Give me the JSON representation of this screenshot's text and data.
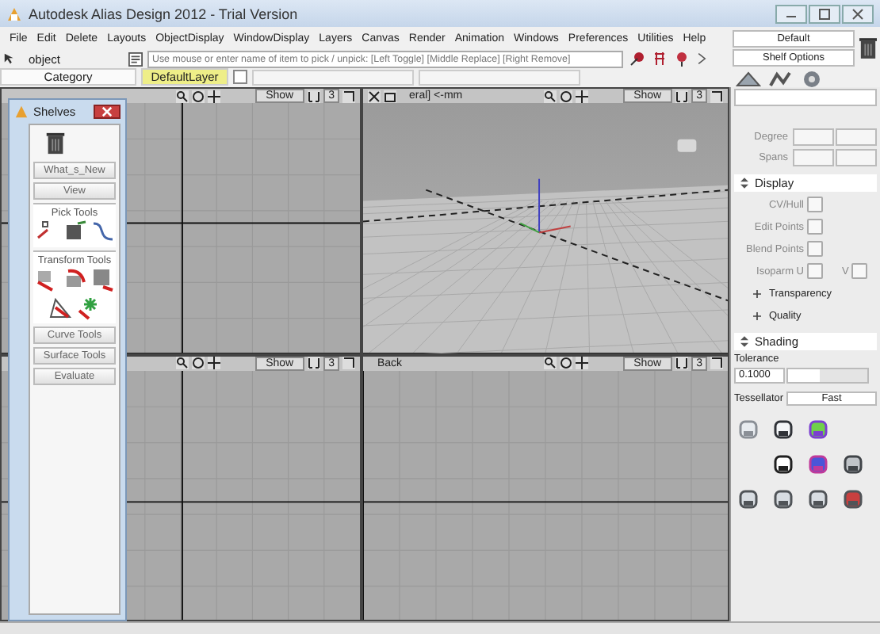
{
  "window": {
    "title": "Autodesk Alias Design 2012 - Trial Version"
  },
  "menu": [
    "File",
    "Edit",
    "Delete",
    "Layouts",
    "ObjectDisplay",
    "WindowDisplay",
    "Layers",
    "Canvas",
    "Render",
    "Animation",
    "Windows",
    "Preferences",
    "Utilities",
    "Help"
  ],
  "command": {
    "mode": "object",
    "prompt": "Use mouse or enter name of item to pick / unpick: [Left Toggle] [Middle Replace] [Right Remove]"
  },
  "layers": {
    "category": "Category",
    "layer": "DefaultLayer",
    "checked": false
  },
  "shelf_selector": {
    "shelf": "Default",
    "options": "Shelf Options"
  },
  "viewports": [
    {
      "kind": "ortho",
      "show": "Show",
      "count": "3"
    },
    {
      "kind": "perspective",
      "label": "eral] <-mm",
      "show": "Show",
      "count": "3"
    },
    {
      "kind": "ortho",
      "show": "Show",
      "count": "3"
    },
    {
      "kind": "ortho",
      "label": "Back",
      "show": "Show",
      "count": "3"
    }
  ],
  "shelves": {
    "title": "Shelves",
    "buttons": [
      "What_s_New",
      "View"
    ],
    "sections": [
      {
        "title": "Pick Tools",
        "kind": "pick"
      },
      {
        "title": "Transform Tools",
        "kind": "transform"
      }
    ],
    "collapsed": [
      "Curve Tools",
      "Surface Tools",
      "Evaluate"
    ]
  },
  "panel": {
    "fields": [
      {
        "label": "Degree"
      },
      {
        "label": "Spans"
      }
    ],
    "display": {
      "title": "Display",
      "toggles": [
        {
          "label": "CV/Hull",
          "checked": false
        },
        {
          "label": "Edit Points",
          "checked": false
        },
        {
          "label": "Blend Points",
          "checked": false
        },
        {
          "label": "Isoparm U",
          "checked": false,
          "extra": "V",
          "extra_checked": false
        }
      ],
      "expanders": [
        "Transparency",
        "Quality"
      ]
    },
    "shading": {
      "title": "Shading",
      "tolerance_label": "Tolerance",
      "tolerance": "0.1000",
      "level": 0.4,
      "tessellator_label": "Tessellator",
      "tessellator": "Fast"
    }
  }
}
